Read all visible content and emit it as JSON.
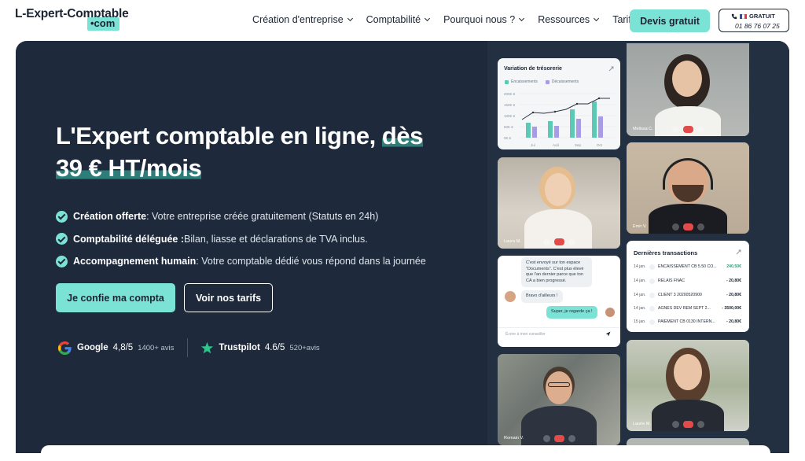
{
  "header": {
    "logo_main": "L-Expert-Comptable",
    "logo_sub": "•com",
    "nav": [
      {
        "label": "Création d'entreprise",
        "dropdown": true
      },
      {
        "label": "Comptabilité",
        "dropdown": true
      },
      {
        "label": "Pourquoi nous ?",
        "dropdown": true
      },
      {
        "label": "Ressources",
        "dropdown": true
      },
      {
        "label": "Tarifs",
        "dropdown": false
      }
    ],
    "devis_label": "Devis gratuit",
    "phone_label": "GRATUIT",
    "phone_number": "01 86 76 07 25"
  },
  "hero": {
    "title_part1": "L'Expert comptable en ligne, ",
    "title_hl1": "dès",
    "title_hl2": "39 € HT/mois",
    "features": [
      {
        "bold": "Création offerte",
        "text": " : Votre entreprise créée gratuitement (Statuts en 24h)"
      },
      {
        "bold": "Comptabilité déléguée :",
        "text": " Bilan, liasse et déclarations de TVA inclus."
      },
      {
        "bold": "Accompagnement humain",
        "text": " : Votre comptable dédié vous répond dans la journée"
      }
    ],
    "cta_primary": "Je confie ma compta",
    "cta_secondary": "Voir nos tarifs",
    "ratings": [
      {
        "name": "Google",
        "score": "4,8/5",
        "count": "1400+ avis",
        "icon": "google-icon"
      },
      {
        "name": "Trustpilot",
        "score": "4.6/5",
        "count": "520+avis",
        "icon": "trustpilot-star-icon"
      }
    ]
  },
  "cards": {
    "chart": {
      "title": "Variation de trésorerie",
      "legend": [
        "Encaissements",
        "Décaissements"
      ],
      "yticks": [
        "200K €",
        "150K €",
        "100K €",
        "50K €",
        "0K €"
      ],
      "xticks": [
        "Jui",
        "Aoû",
        "Sep",
        "Oct"
      ]
    },
    "video_names": [
      "Melissa C.",
      "Laura M.",
      "Emir V.",
      "Romain V.",
      "Laurie M."
    ],
    "chat": {
      "msg1": "C'est envoyé sur ton espace \"Documents\". C'est plus élevé que l'an dernier parce que ton CA a bien progressé.",
      "msg2": "Bravo d'ailleurs !",
      "msg3": "Super, je regarde ça !",
      "input_placeholder": "Écrire à mon conseiller"
    },
    "transactions": {
      "title": "Dernières transactions",
      "rows": [
        {
          "date": "14 jan.",
          "label": "ENCAISSEMENT CB 5.50 CO...",
          "amount": "240,50€",
          "positive": true
        },
        {
          "date": "14 jan.",
          "label": "RELAIS FNAC",
          "amount": "- 20,80€",
          "positive": false
        },
        {
          "date": "14 jan.",
          "label": "CLIENT 3 20200520900",
          "amount": "- 20,80€",
          "positive": false
        },
        {
          "date": "14 jan.",
          "label": "AGNES DEV REM SEPT 2...",
          "amount": "- 3500,00€",
          "positive": false
        },
        {
          "date": "15 jan.",
          "label": "PAIEMENT CB 0130 INTERN...",
          "amount": "- 20,80€",
          "positive": false
        }
      ]
    }
  },
  "colors": {
    "accent": "#7be3d6",
    "hero_bg": "#1e2a3b",
    "text_dark": "#1b2432",
    "chart_green": "#5cc9b6",
    "chart_purple": "#a99ce6",
    "positive": "#2ba37a"
  }
}
